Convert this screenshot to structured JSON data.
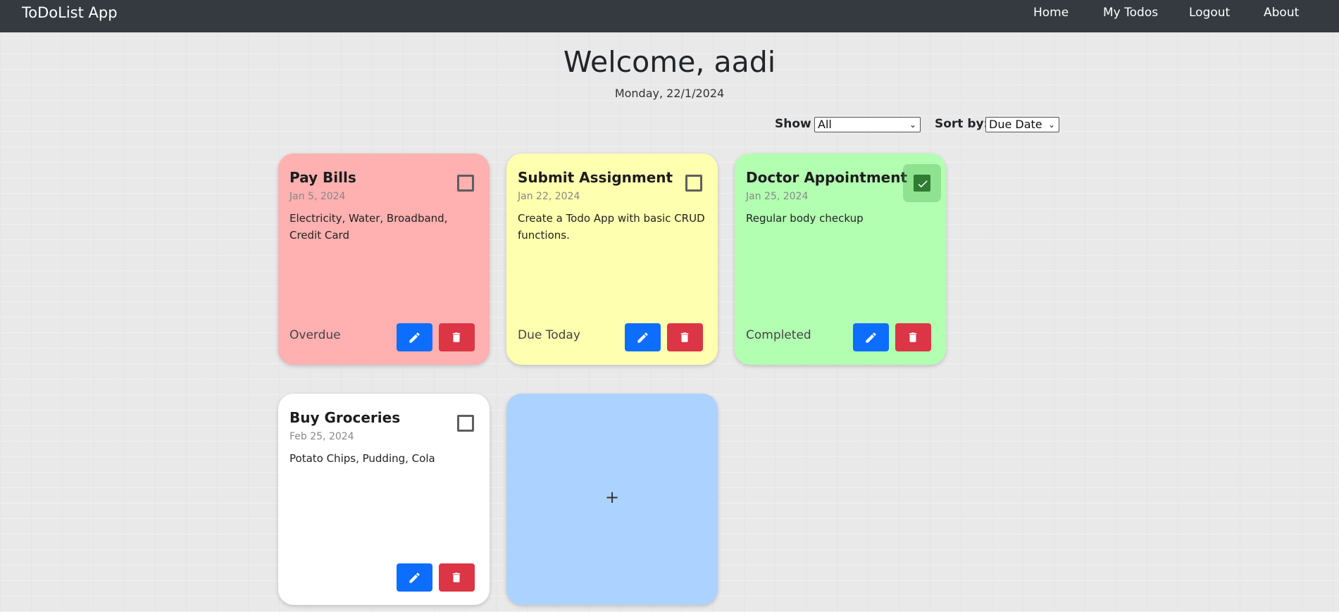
{
  "navbar": {
    "brand": "ToDoList App",
    "links": [
      "Home",
      "My Todos",
      "Logout",
      "About"
    ]
  },
  "header": {
    "welcome": "Welcome, aadi",
    "date": "Monday, 22/1/2024"
  },
  "filters": {
    "show_label": "Show",
    "show_value": "All",
    "sort_label": "Sort by:",
    "sort_value": "Due Date"
  },
  "todos": [
    {
      "title": "Pay Bills",
      "due": "Jan 5, 2024",
      "description": "Electricity, Water, Broadband, Credit Card",
      "status": "Overdue",
      "completed": false,
      "color": "#ffb0b0"
    },
    {
      "title": "Submit Assignment",
      "due": "Jan 22, 2024",
      "description": "Create a Todo App with basic CRUD functions.",
      "status": "Due Today",
      "completed": false,
      "color": "#ffffb0"
    },
    {
      "title": "Doctor Appointment",
      "due": "Jan 25, 2024",
      "description": "Regular body checkup",
      "status": "Completed",
      "completed": true,
      "color": "#b2ffb2"
    },
    {
      "title": "Buy Groceries",
      "due": "Feb 25, 2024",
      "description": "Potato Chips, Pudding, Cola",
      "status": "",
      "completed": false,
      "color": "#ffffff"
    }
  ],
  "add_card": {
    "label": "+",
    "color": "#acd2ff"
  },
  "colors": {
    "edit": "#0d6efd",
    "delete": "#dc3545",
    "navbar": "#343a40",
    "checked": "#2e7d32"
  },
  "icons": {
    "edit": "pencil-icon",
    "delete": "trash-icon",
    "add": "plus-icon"
  }
}
